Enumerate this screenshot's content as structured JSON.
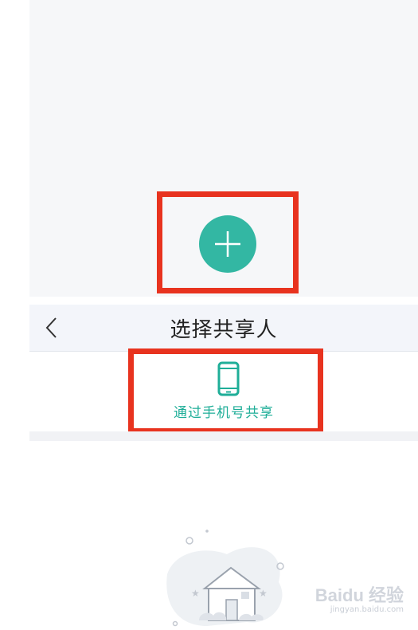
{
  "nav": {
    "back_icon": "chevron-left-icon",
    "title": "选择共享人"
  },
  "share_option": {
    "icon": "phone-icon",
    "label": "通过手机号共享"
  },
  "add_button": {
    "icon": "plus-icon",
    "color": "#33b7a3"
  },
  "highlight_color": "#e8331f",
  "accent_color": "#1fae98",
  "empty_state": {
    "icon": "house-illustration"
  },
  "watermark": {
    "logo": "Baidu 经验",
    "url": "jingyan.baidu.com"
  }
}
